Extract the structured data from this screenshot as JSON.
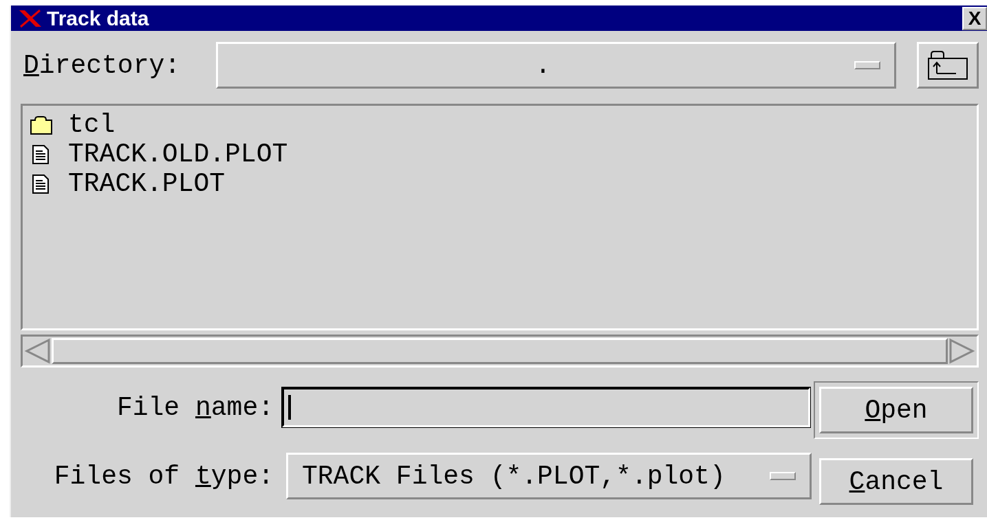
{
  "window": {
    "title": "Track data",
    "close": "X"
  },
  "directory": {
    "label": {
      "key": "D",
      "post": "irectory:"
    },
    "value": "."
  },
  "files": [
    {
      "kind": "folder",
      "name": "tcl"
    },
    {
      "kind": "file",
      "name": "TRACK.OLD.PLOT"
    },
    {
      "kind": "file",
      "name": "TRACK.PLOT"
    }
  ],
  "file_name": {
    "label": {
      "pre": "File ",
      "key": "n",
      "post": "ame:"
    }
  },
  "file_type": {
    "label": {
      "pre": "Files of ",
      "key": "t",
      "post": "ype:"
    },
    "value": "TRACK Files (*.PLOT,*.plot)"
  },
  "buttons": [
    {
      "label": {
        "key": "O",
        "post": "pen"
      },
      "default": true
    },
    {
      "label": {
        "key": "C",
        "post": "ancel"
      },
      "default": false
    }
  ]
}
